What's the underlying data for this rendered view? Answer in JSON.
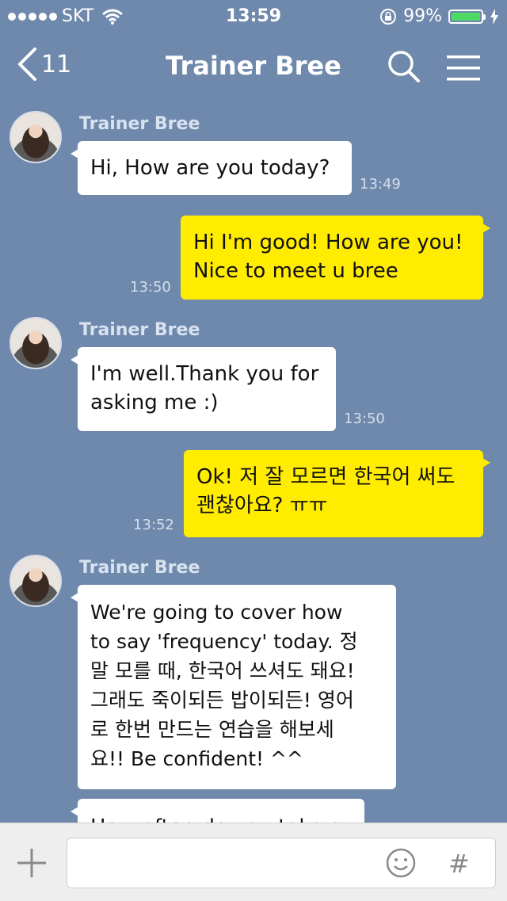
{
  "status_bar": {
    "carrier": "SKT",
    "time": "13:59",
    "battery": "99%",
    "battery_level": 0.99
  },
  "nav": {
    "back_count": "11",
    "title": "Trainer Bree"
  },
  "messages": [
    {
      "sender": "Trainer Bree",
      "text": "Hi, How are you today?",
      "time": "13:49"
    },
    {
      "text": "Hi I'm good! How are you!\nNice to meet u bree",
      "time": "13:50"
    },
    {
      "sender": "Trainer Bree",
      "text": "I'm well.Thank you for\nasking me :)",
      "time": "13:50"
    },
    {
      "text": "Ok! 저 잘 모르면 한국어 써도\n괜찮아요? ㅠㅠ",
      "time": "13:52"
    },
    {
      "sender": "Trainer Bree",
      "text": "We're going to cover how\nto say 'frequency' today. 정\n말 모를 때, 한국어 쓰셔도 돼요!\n그래도 죽이되든 밥이되든! 영어\n로 한번 만드는 연습을 해보세\n요!! Be confident! ^^"
    },
    {
      "text": "How often do you take a"
    }
  ],
  "input": {
    "placeholder": ""
  },
  "colors": {
    "chat_bg": "#6f89ad",
    "outgoing_bubble": "#ffec00",
    "incoming_bubble": "#ffffff"
  }
}
